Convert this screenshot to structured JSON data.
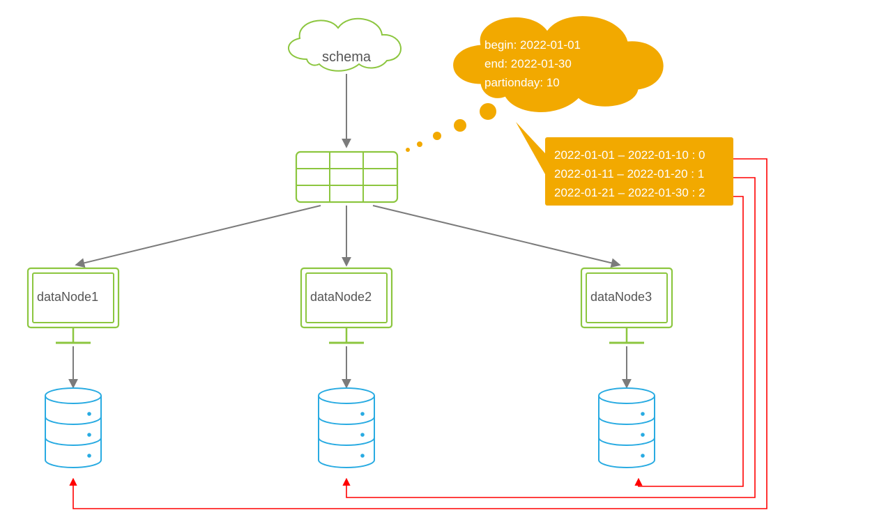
{
  "schema": {
    "label": "schema"
  },
  "config": {
    "begin": "begin: 2022-01-01",
    "end": "end: 2022-01-30",
    "partitionday": "partionday: 10"
  },
  "ranges": {
    "r0": "2022-01-01 – 2022-01-10 : 0",
    "r1": "2022-01-11 – 2022-01-20 : 1",
    "r2": "2022-01-21 – 2022-01-30 : 2"
  },
  "nodes": {
    "n1": "dataNode1",
    "n2": "dataNode2",
    "n3": "dataNode3"
  }
}
